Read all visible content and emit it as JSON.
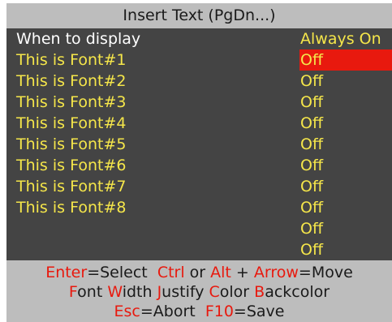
{
  "title": "Insert Text (PgDn...)",
  "colors": {
    "label_white": "#ffffff",
    "label_yellow": "#f5e64a",
    "value_yellow": "#f5e64a",
    "highlight_bg": "#e8190e",
    "highlight_text": "#f5e64a",
    "panel_bg": "#444444",
    "bar_bg": "#bdbdbd",
    "hotkey_red": "#e8190e"
  },
  "rows": [
    {
      "label": "When to display",
      "value": "Always On",
      "label_color": "white",
      "selected": false
    },
    {
      "label": "This is Font#1",
      "value": "Off",
      "label_color": "yellow",
      "selected": true
    },
    {
      "label": "This is Font#2",
      "value": "Off",
      "label_color": "yellow",
      "selected": false
    },
    {
      "label": "This is Font#3",
      "value": "Off",
      "label_color": "yellow",
      "selected": false
    },
    {
      "label": "This is Font#4",
      "value": "Off",
      "label_color": "yellow",
      "selected": false
    },
    {
      "label": "This is Font#5",
      "value": "Off",
      "label_color": "yellow",
      "selected": false
    },
    {
      "label": "This is Font#6",
      "value": "Off",
      "label_color": "yellow",
      "selected": false
    },
    {
      "label": "This is Font#7",
      "value": "Off",
      "label_color": "yellow",
      "selected": false
    },
    {
      "label": "This is Font#8",
      "value": "Off",
      "label_color": "yellow",
      "selected": false
    },
    {
      "label": "",
      "value": "Off",
      "label_color": "yellow",
      "selected": false
    },
    {
      "label": "",
      "value": "Off",
      "label_color": "yellow",
      "selected": false
    }
  ],
  "help": {
    "line1": [
      {
        "text": "Enter",
        "red": true
      },
      {
        "text": "=Select  ",
        "red": false
      },
      {
        "text": "Ctrl",
        "red": true
      },
      {
        "text": " or ",
        "red": false
      },
      {
        "text": "Alt",
        "red": true
      },
      {
        "text": " + ",
        "red": false
      },
      {
        "text": "Arrow",
        "red": true
      },
      {
        "text": "=Move",
        "red": false
      }
    ],
    "line2": [
      {
        "text": "F",
        "red": true
      },
      {
        "text": "ont ",
        "red": false
      },
      {
        "text": "W",
        "red": true
      },
      {
        "text": "idth ",
        "red": false
      },
      {
        "text": "J",
        "red": true
      },
      {
        "text": "ustify ",
        "red": false
      },
      {
        "text": "C",
        "red": true
      },
      {
        "text": "olor ",
        "red": false
      },
      {
        "text": "B",
        "red": true
      },
      {
        "text": "ackcolor",
        "red": false
      }
    ],
    "line3": [
      {
        "text": "Esc",
        "red": true
      },
      {
        "text": "=Abort  ",
        "red": false
      },
      {
        "text": "F10",
        "red": true
      },
      {
        "text": "=Save",
        "red": false
      }
    ]
  }
}
